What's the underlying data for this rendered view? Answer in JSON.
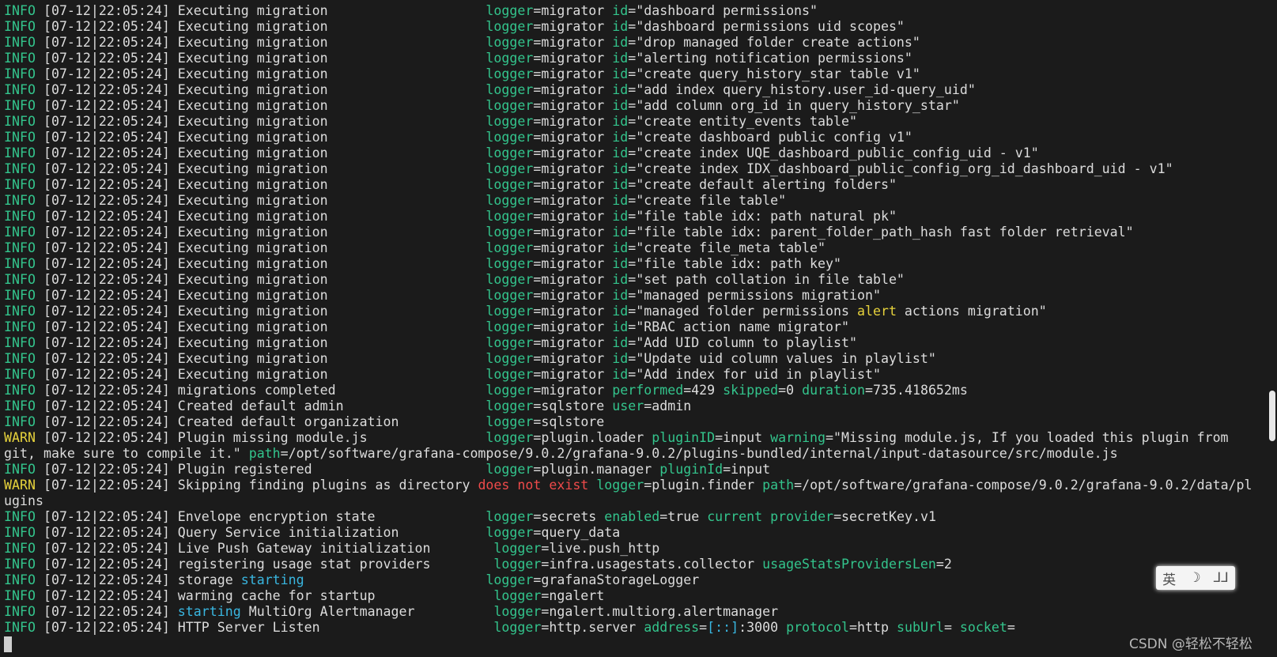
{
  "terminal": {
    "lines": [
      [
        {
          "t": "INFO",
          "c": "lv"
        },
        {
          "t": " [07-12|22:05:24] Executing migration                    "
        },
        {
          "t": "logger",
          "c": "k"
        },
        {
          "t": "=migrator "
        },
        {
          "t": "id",
          "c": "k"
        },
        {
          "t": "=\"dashboard permissions\""
        }
      ],
      [
        {
          "t": "INFO",
          "c": "lv"
        },
        {
          "t": " [07-12|22:05:24] Executing migration                    "
        },
        {
          "t": "logger",
          "c": "k"
        },
        {
          "t": "=migrator "
        },
        {
          "t": "id",
          "c": "k"
        },
        {
          "t": "=\"dashboard permissions uid scopes\""
        }
      ],
      [
        {
          "t": "INFO",
          "c": "lv"
        },
        {
          "t": " [07-12|22:05:24] Executing migration                    "
        },
        {
          "t": "logger",
          "c": "k"
        },
        {
          "t": "=migrator "
        },
        {
          "t": "id",
          "c": "k"
        },
        {
          "t": "=\"drop managed folder create actions\""
        }
      ],
      [
        {
          "t": "INFO",
          "c": "lv"
        },
        {
          "t": " [07-12|22:05:24] Executing migration                    "
        },
        {
          "t": "logger",
          "c": "k"
        },
        {
          "t": "=migrator "
        },
        {
          "t": "id",
          "c": "k"
        },
        {
          "t": "=\"alerting notification permissions\""
        }
      ],
      [
        {
          "t": "INFO",
          "c": "lv"
        },
        {
          "t": " [07-12|22:05:24] Executing migration                    "
        },
        {
          "t": "logger",
          "c": "k"
        },
        {
          "t": "=migrator "
        },
        {
          "t": "id",
          "c": "k"
        },
        {
          "t": "=\"create query_history_star table v1\""
        }
      ],
      [
        {
          "t": "INFO",
          "c": "lv"
        },
        {
          "t": " [07-12|22:05:24] Executing migration                    "
        },
        {
          "t": "logger",
          "c": "k"
        },
        {
          "t": "=migrator "
        },
        {
          "t": "id",
          "c": "k"
        },
        {
          "t": "=\"add index query_history.user_id-query_uid\""
        }
      ],
      [
        {
          "t": "INFO",
          "c": "lv"
        },
        {
          "t": " [07-12|22:05:24] Executing migration                    "
        },
        {
          "t": "logger",
          "c": "k"
        },
        {
          "t": "=migrator "
        },
        {
          "t": "id",
          "c": "k"
        },
        {
          "t": "=\"add column org_id in query_history_star\""
        }
      ],
      [
        {
          "t": "INFO",
          "c": "lv"
        },
        {
          "t": " [07-12|22:05:24] Executing migration                    "
        },
        {
          "t": "logger",
          "c": "k"
        },
        {
          "t": "=migrator "
        },
        {
          "t": "id",
          "c": "k"
        },
        {
          "t": "=\"create entity_events table\""
        }
      ],
      [
        {
          "t": "INFO",
          "c": "lv"
        },
        {
          "t": " [07-12|22:05:24] Executing migration                    "
        },
        {
          "t": "logger",
          "c": "k"
        },
        {
          "t": "=migrator "
        },
        {
          "t": "id",
          "c": "k"
        },
        {
          "t": "=\"create dashboard public config v1\""
        }
      ],
      [
        {
          "t": "INFO",
          "c": "lv"
        },
        {
          "t": " [07-12|22:05:24] Executing migration                    "
        },
        {
          "t": "logger",
          "c": "k"
        },
        {
          "t": "=migrator "
        },
        {
          "t": "id",
          "c": "k"
        },
        {
          "t": "=\"create index UQE_dashboard_public_config_uid - v1\""
        }
      ],
      [
        {
          "t": "INFO",
          "c": "lv"
        },
        {
          "t": " [07-12|22:05:24] Executing migration                    "
        },
        {
          "t": "logger",
          "c": "k"
        },
        {
          "t": "=migrator "
        },
        {
          "t": "id",
          "c": "k"
        },
        {
          "t": "=\"create index IDX_dashboard_public_config_org_id_dashboard_uid - v1\""
        }
      ],
      [
        {
          "t": "INFO",
          "c": "lv"
        },
        {
          "t": " [07-12|22:05:24] Executing migration                    "
        },
        {
          "t": "logger",
          "c": "k"
        },
        {
          "t": "=migrator "
        },
        {
          "t": "id",
          "c": "k"
        },
        {
          "t": "=\"create default alerting folders\""
        }
      ],
      [
        {
          "t": "INFO",
          "c": "lv"
        },
        {
          "t": " [07-12|22:05:24] Executing migration                    "
        },
        {
          "t": "logger",
          "c": "k"
        },
        {
          "t": "=migrator "
        },
        {
          "t": "id",
          "c": "k"
        },
        {
          "t": "=\"create file table\""
        }
      ],
      [
        {
          "t": "INFO",
          "c": "lv"
        },
        {
          "t": " [07-12|22:05:24] Executing migration                    "
        },
        {
          "t": "logger",
          "c": "k"
        },
        {
          "t": "=migrator "
        },
        {
          "t": "id",
          "c": "k"
        },
        {
          "t": "=\"file table idx: path natural pk\""
        }
      ],
      [
        {
          "t": "INFO",
          "c": "lv"
        },
        {
          "t": " [07-12|22:05:24] Executing migration                    "
        },
        {
          "t": "logger",
          "c": "k"
        },
        {
          "t": "=migrator "
        },
        {
          "t": "id",
          "c": "k"
        },
        {
          "t": "=\"file table idx: parent_folder_path_hash fast folder retrieval\""
        }
      ],
      [
        {
          "t": "INFO",
          "c": "lv"
        },
        {
          "t": " [07-12|22:05:24] Executing migration                    "
        },
        {
          "t": "logger",
          "c": "k"
        },
        {
          "t": "=migrator "
        },
        {
          "t": "id",
          "c": "k"
        },
        {
          "t": "=\"create file_meta table\""
        }
      ],
      [
        {
          "t": "INFO",
          "c": "lv"
        },
        {
          "t": " [07-12|22:05:24] Executing migration                    "
        },
        {
          "t": "logger",
          "c": "k"
        },
        {
          "t": "=migrator "
        },
        {
          "t": "id",
          "c": "k"
        },
        {
          "t": "=\"file table idx: path key\""
        }
      ],
      [
        {
          "t": "INFO",
          "c": "lv"
        },
        {
          "t": " [07-12|22:05:24] Executing migration                    "
        },
        {
          "t": "logger",
          "c": "k"
        },
        {
          "t": "=migrator "
        },
        {
          "t": "id",
          "c": "k"
        },
        {
          "t": "=\"set path collation in file table\""
        }
      ],
      [
        {
          "t": "INFO",
          "c": "lv"
        },
        {
          "t": " [07-12|22:05:24] Executing migration                    "
        },
        {
          "t": "logger",
          "c": "k"
        },
        {
          "t": "=migrator "
        },
        {
          "t": "id",
          "c": "k"
        },
        {
          "t": "=\"managed permissions migration\""
        }
      ],
      [
        {
          "t": "INFO",
          "c": "lv"
        },
        {
          "t": " [07-12|22:05:24] Executing migration                    "
        },
        {
          "t": "logger",
          "c": "k"
        },
        {
          "t": "=migrator "
        },
        {
          "t": "id",
          "c": "k"
        },
        {
          "t": "=\"managed folder permissions "
        },
        {
          "t": "alert",
          "c": "wy"
        },
        {
          "t": " actions migration\""
        }
      ],
      [
        {
          "t": "INFO",
          "c": "lv"
        },
        {
          "t": " [07-12|22:05:24] Executing migration                    "
        },
        {
          "t": "logger",
          "c": "k"
        },
        {
          "t": "=migrator "
        },
        {
          "t": "id",
          "c": "k"
        },
        {
          "t": "=\"RBAC action name migrator\""
        }
      ],
      [
        {
          "t": "INFO",
          "c": "lv"
        },
        {
          "t": " [07-12|22:05:24] Executing migration                    "
        },
        {
          "t": "logger",
          "c": "k"
        },
        {
          "t": "=migrator "
        },
        {
          "t": "id",
          "c": "k"
        },
        {
          "t": "=\"Add UID column to playlist\""
        }
      ],
      [
        {
          "t": "INFO",
          "c": "lv"
        },
        {
          "t": " [07-12|22:05:24] Executing migration                    "
        },
        {
          "t": "logger",
          "c": "k"
        },
        {
          "t": "=migrator "
        },
        {
          "t": "id",
          "c": "k"
        },
        {
          "t": "=\"Update uid column values in playlist\""
        }
      ],
      [
        {
          "t": "INFO",
          "c": "lv"
        },
        {
          "t": " [07-12|22:05:24] Executing migration                    "
        },
        {
          "t": "logger",
          "c": "k"
        },
        {
          "t": "=migrator "
        },
        {
          "t": "id",
          "c": "k"
        },
        {
          "t": "=\"Add index for uid in playlist\""
        }
      ],
      [
        {
          "t": "INFO",
          "c": "lv"
        },
        {
          "t": " [07-12|22:05:24] migrations completed                   "
        },
        {
          "t": "logger",
          "c": "k"
        },
        {
          "t": "=migrator "
        },
        {
          "t": "performed",
          "c": "k"
        },
        {
          "t": "=429 "
        },
        {
          "t": "skipped",
          "c": "k"
        },
        {
          "t": "=0 "
        },
        {
          "t": "duration",
          "c": "k"
        },
        {
          "t": "=735.418652ms"
        }
      ],
      [
        {
          "t": "INFO",
          "c": "lv"
        },
        {
          "t": " [07-12|22:05:24] Created default admin                  "
        },
        {
          "t": "logger",
          "c": "k"
        },
        {
          "t": "=sqlstore "
        },
        {
          "t": "user",
          "c": "k"
        },
        {
          "t": "=admin"
        }
      ],
      [
        {
          "t": "INFO",
          "c": "lv"
        },
        {
          "t": " [07-12|22:05:24] Created default organization           "
        },
        {
          "t": "logger",
          "c": "k"
        },
        {
          "t": "=sqlstore"
        }
      ],
      [
        {
          "t": "WARN",
          "c": "lv"
        },
        {
          "t": " [07-12|22:05:24] Plugin missing module.js               "
        },
        {
          "t": "logger",
          "c": "k"
        },
        {
          "t": "=plugin.loader "
        },
        {
          "t": "pluginID",
          "c": "k"
        },
        {
          "t": "=input "
        },
        {
          "t": "warning",
          "c": "k"
        },
        {
          "t": "=\"Missing module.js, If you loaded this plugin from"
        }
      ],
      [
        {
          "t": "git, make sure to compile it.\" "
        },
        {
          "t": "path",
          "c": "k"
        },
        {
          "t": "=/opt/software/grafana-compose/9.0.2/grafana-9.0.2/plugins-bundled/internal/input-datasource/src/module.js"
        }
      ],
      [
        {
          "t": "INFO",
          "c": "lv"
        },
        {
          "t": " [07-12|22:05:24] Plugin registered                      "
        },
        {
          "t": "logger",
          "c": "k"
        },
        {
          "t": "=plugin.manager "
        },
        {
          "t": "pluginId",
          "c": "k"
        },
        {
          "t": "=input"
        }
      ],
      [
        {
          "t": "WARN",
          "c": "lv"
        },
        {
          "t": " [07-12|22:05:24] Skipping finding plugins as directory "
        },
        {
          "t": "does not exist",
          "c": "wr"
        },
        {
          "t": " "
        },
        {
          "t": "logger",
          "c": "k"
        },
        {
          "t": "=plugin.finder "
        },
        {
          "t": "path",
          "c": "k"
        },
        {
          "t": "=/opt/software/grafana-compose/9.0.2/grafana-9.0.2/data/pl"
        }
      ],
      [
        {
          "t": "ugins"
        }
      ],
      [
        {
          "t": "INFO",
          "c": "lv"
        },
        {
          "t": " [07-12|22:05:24] Envelope encryption state              "
        },
        {
          "t": "logger",
          "c": "k"
        },
        {
          "t": "=secrets "
        },
        {
          "t": "enabled",
          "c": "k"
        },
        {
          "t": "=true "
        },
        {
          "t": "current",
          "c": "k"
        },
        {
          "t": " "
        },
        {
          "t": "provider",
          "c": "k"
        },
        {
          "t": "=secretKey.v1"
        }
      ],
      [
        {
          "t": "INFO",
          "c": "lv"
        },
        {
          "t": " [07-12|22:05:24] Query Service initialization           "
        },
        {
          "t": "logger",
          "c": "k"
        },
        {
          "t": "=query_data"
        }
      ],
      [
        {
          "t": "INFO",
          "c": "lv"
        },
        {
          "t": " [07-12|22:05:24] Live Push Gateway initialization        "
        },
        {
          "t": "logger",
          "c": "k"
        },
        {
          "t": "=live.push_http"
        }
      ],
      [
        {
          "t": "INFO",
          "c": "lv"
        },
        {
          "t": " [07-12|22:05:24] registering usage stat providers        "
        },
        {
          "t": "logger",
          "c": "k"
        },
        {
          "t": "=infra.usagestats.collector "
        },
        {
          "t": "usageStatsProvidersLen",
          "c": "k"
        },
        {
          "t": "=2"
        }
      ],
      [
        {
          "t": "INFO",
          "c": "lv"
        },
        {
          "t": " [07-12|22:05:24] storage "
        },
        {
          "t": "starting",
          "c": "wc"
        },
        {
          "t": "                       "
        },
        {
          "t": "logger",
          "c": "k"
        },
        {
          "t": "=grafanaStorageLogger"
        }
      ],
      [
        {
          "t": "INFO",
          "c": "lv"
        },
        {
          "t": " [07-12|22:05:24] warming cache for startup               "
        },
        {
          "t": "logger",
          "c": "k"
        },
        {
          "t": "=ngalert"
        }
      ],
      [
        {
          "t": "INFO",
          "c": "lv"
        },
        {
          "t": " [07-12|22:05:24] "
        },
        {
          "t": "starting",
          "c": "wc"
        },
        {
          "t": " MultiOrg Alertmanager          "
        },
        {
          "t": "logger",
          "c": "k"
        },
        {
          "t": "=ngalert.multiorg.alertmanager"
        }
      ],
      [
        {
          "t": "INFO",
          "c": "lv"
        },
        {
          "t": " [07-12|22:05:24] HTTP Server Listen                      "
        },
        {
          "t": "logger",
          "c": "k"
        },
        {
          "t": "=http.server "
        },
        {
          "t": "address",
          "c": "k"
        },
        {
          "t": "="
        },
        {
          "t": "[::]",
          "c": "wc"
        },
        {
          "t": ":3000 "
        },
        {
          "t": "protocol",
          "c": "k"
        },
        {
          "t": "=http "
        },
        {
          "t": "subUrl",
          "c": "k"
        },
        {
          "t": "= "
        },
        {
          "t": "socket",
          "c": "k"
        },
        {
          "t": "="
        }
      ]
    ]
  },
  "ime": {
    "lang": "英",
    "moon": "☽",
    "width_mode": "⅃⅃"
  },
  "watermark": "CSDN @轻松不轻松",
  "colors": {
    "background": "#1b1b1b",
    "text": "#dcdcdc",
    "info_level": "#33c48c",
    "warn_level": "#e6d23c",
    "keyword_red": "#ee4a4a",
    "keyword_cyan": "#39b6e0"
  }
}
